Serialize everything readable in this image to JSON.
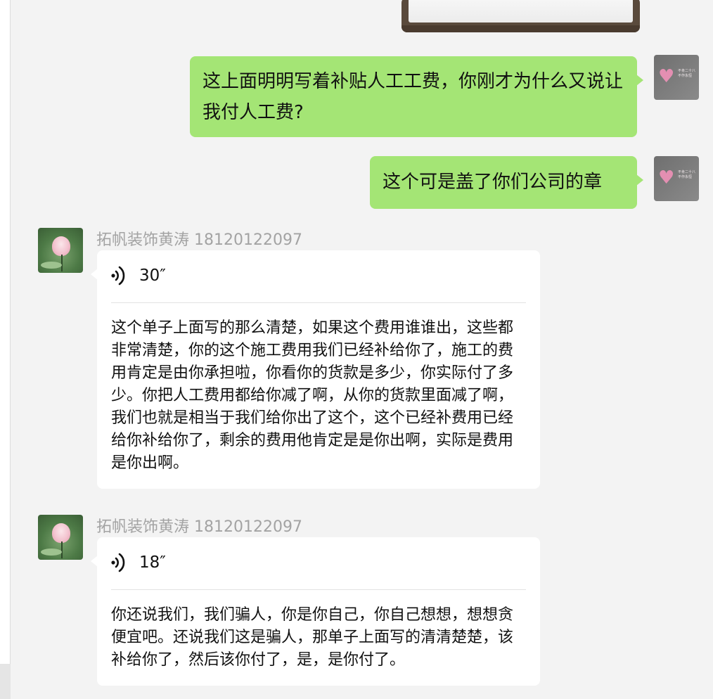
{
  "chat": {
    "messages": [
      {
        "type": "image",
        "from": "self"
      },
      {
        "type": "text",
        "from": "self",
        "text": "这上面明明写着补贴人工工费，你刚才为什么又说让我付人工费?"
      },
      {
        "type": "text",
        "from": "self",
        "text": "这个可是盖了你们公司的章"
      },
      {
        "type": "voice",
        "from": "other",
        "sender": "拓帆装饰黄涛 18120122097",
        "duration": "30″",
        "transcript": "这个单子上面写的那么清楚，如果这个费用谁谁出，这些都非常清楚，你的这个施工费用我们已经补给你了，施工的费用肯定是由你承担啦，你看你的货款是多少，你实际付了多少。你把人工费用都给你减了啊，从你的货款里面减了啊，我们也就是相当于我们给你出了这个，这个已经补费用已经给你补给你了，剩余的费用他肯定是是你出啊，实际是费用是你出啊。"
      },
      {
        "type": "voice",
        "from": "other",
        "sender": "拓帆装饰黄涛 18120122097",
        "duration": "18″",
        "transcript": "你还说我们，我们骗人，你是你自己，你自己想想，想想贪便宜吧。还说我们这是骗人，那单子上面写的清清楚楚，该补给你了，然后该你付了，是，是你付了。"
      }
    ]
  },
  "self_avatar": {
    "caption": "不肯二十八\n不作永恒"
  },
  "colors": {
    "background": "#f3f3f3",
    "self_bubble": "#a4e575",
    "other_bubble": "#ffffff",
    "sender_name": "#a3a3a3"
  }
}
